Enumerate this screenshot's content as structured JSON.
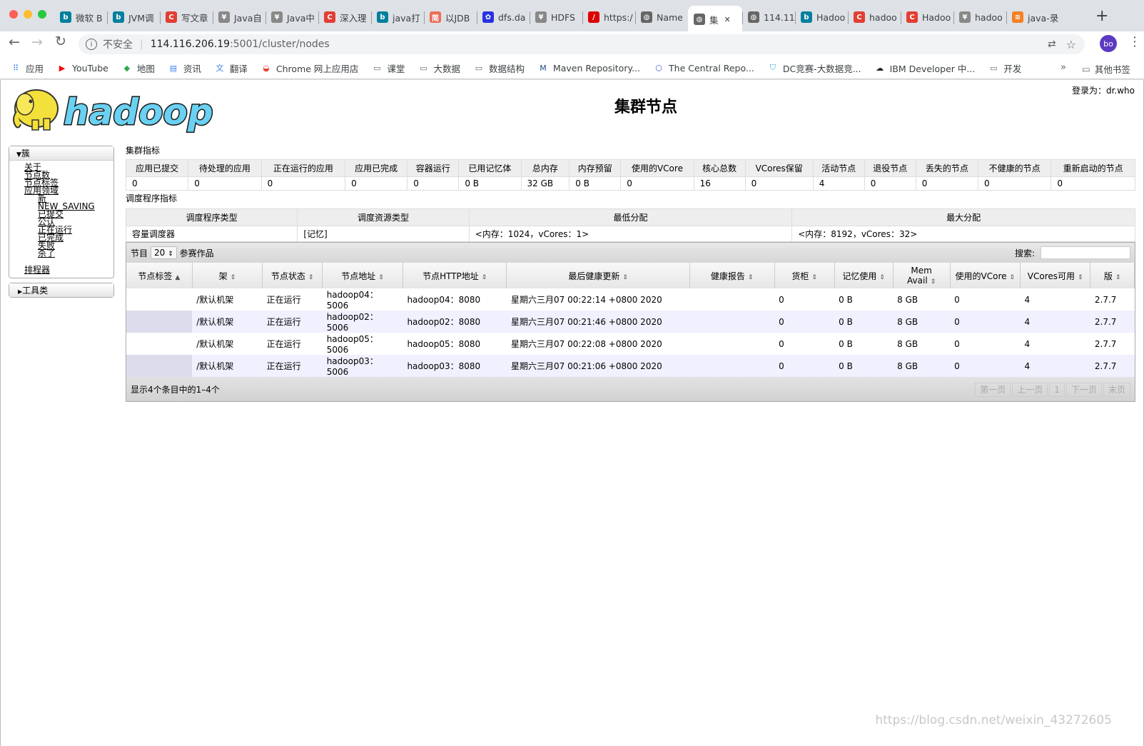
{
  "browser": {
    "tabs": [
      {
        "label": "微软 B",
        "fav": "b",
        "color": "#00809d"
      },
      {
        "label": "JVM调",
        "fav": "b",
        "color": "#00809d"
      },
      {
        "label": "写文章",
        "fav": "C",
        "color": "#e33e33"
      },
      {
        "label": "Java自",
        "fav": "¥",
        "color": "#888"
      },
      {
        "label": "Java中",
        "fav": "¥",
        "color": "#888"
      },
      {
        "label": "深入理",
        "fav": "C",
        "color": "#e33e33"
      },
      {
        "label": "java打",
        "fav": "b",
        "color": "#00809d"
      },
      {
        "label": "以JDB",
        "fav": "简",
        "color": "#ea6f5a"
      },
      {
        "label": "dfs.da",
        "fav": "✿",
        "color": "#2932e1"
      },
      {
        "label": "HDFS",
        "fav": "¥",
        "color": "#888"
      },
      {
        "label": "https:/",
        "fav": "/",
        "color": "#d00"
      },
      {
        "label": "Name",
        "fav": "◍",
        "color": "#666"
      },
      {
        "label": "集",
        "fav": "◍",
        "color": "#666",
        "active": true
      },
      {
        "label": "114.11",
        "fav": "◍",
        "color": "#666"
      },
      {
        "label": "Hadoo",
        "fav": "b",
        "color": "#00809d"
      },
      {
        "label": "hadoo",
        "fav": "C",
        "color": "#e33e33"
      },
      {
        "label": "Hadoo",
        "fav": "C",
        "color": "#e33e33"
      },
      {
        "label": "hadoo",
        "fav": "¥",
        "color": "#888"
      },
      {
        "label": "java-录",
        "fav": "≋",
        "color": "#f48024"
      }
    ],
    "new_tab": "+",
    "security_label": "不安全",
    "url_host": "114.116.206.19",
    "url_rest": ":5001/cluster/nodes",
    "avatar": "bo",
    "bookmarks": [
      {
        "label": "应用",
        "icon": "apps-grid-icon",
        "glyph": "⠿",
        "color": "#1a73e8"
      },
      {
        "label": "YouTube",
        "icon": "youtube-icon",
        "glyph": "▶",
        "color": "#ff0000"
      },
      {
        "label": "地图",
        "icon": "maps-icon",
        "glyph": "◆",
        "color": "#34a853"
      },
      {
        "label": "资讯",
        "icon": "news-icon",
        "glyph": "▤",
        "color": "#4285f4"
      },
      {
        "label": "翻译",
        "icon": "translate-icon",
        "glyph": "文",
        "color": "#4285f4"
      },
      {
        "label": "Chrome 网上应用店",
        "icon": "webstore-icon",
        "glyph": "◒",
        "color": "#ea4335"
      },
      {
        "label": "课堂",
        "icon": "folder-icon",
        "glyph": "▭",
        "color": "#5f6368"
      },
      {
        "label": "大数据",
        "icon": "folder-icon",
        "glyph": "▭",
        "color": "#5f6368"
      },
      {
        "label": "数据结构",
        "icon": "folder-icon",
        "glyph": "▭",
        "color": "#5f6368"
      },
      {
        "label": "Maven Repository...",
        "icon": "maven-icon",
        "glyph": "M",
        "color": "#1a4c8b"
      },
      {
        "label": "The Central Repo...",
        "icon": "hexagon-icon",
        "glyph": "⬡",
        "color": "#3b5bdb"
      },
      {
        "label": "DC竞赛-大数据竞...",
        "icon": "dc-shield-icon",
        "glyph": "⛉",
        "color": "#3aa7d8"
      },
      {
        "label": "IBM Developer 中...",
        "icon": "ibm-icon",
        "glyph": "☁",
        "color": "#222"
      },
      {
        "label": "开发",
        "icon": "folder-icon",
        "glyph": "▭",
        "color": "#5f6368"
      }
    ],
    "more": "»",
    "other_bookmarks": "其他书签"
  },
  "header": {
    "logo_text": "hadoop",
    "title": "集群节点",
    "login": "登录为：dr.who"
  },
  "nav": {
    "cluster_label": "簇",
    "links": [
      "关于",
      "节点数",
      "节点标签",
      "应用领域"
    ],
    "app_states": [
      "新",
      "NEW_SAVING",
      "已提交",
      "公认",
      "正在运行",
      "已完成",
      "失败",
      "杀了"
    ],
    "scheduler": "排程器",
    "tools_label": "工具类"
  },
  "cluster_metrics": {
    "title": "集群指标",
    "headers": [
      "应用已提交",
      "待处理的应用",
      "正在运行的应用",
      "应用已完成",
      "容器运行",
      "已用记忆体",
      "总内存",
      "内存预留",
      "使用的VCore",
      "核心总数",
      "VCores保留",
      "活动节点",
      "退役节点",
      "丢失的节点",
      "不健康的节点",
      "重新启动的节点"
    ],
    "values": [
      "0",
      "0",
      "0",
      "0",
      "0",
      "0 B",
      "32 GB",
      "0 B",
      "0",
      "16",
      "0",
      "4",
      "0",
      "0",
      "0",
      "0"
    ]
  },
  "scheduler_metrics": {
    "title": "调度程序指标",
    "headers": [
      "调度程序类型",
      "调度资源类型",
      "最低分配",
      "最大分配"
    ],
    "values": [
      "容量调度器",
      "[记忆]",
      "<内存：1024，vCores：1>",
      "<内存：8192，vCores：32>"
    ]
  },
  "nodes_table": {
    "length_label_prefix": "节目",
    "length_value": "20",
    "length_label_suffix": "参赛作品",
    "search_label": "搜索:",
    "search_value": "",
    "headers": [
      "节点标签",
      "架",
      "节点状态",
      "节点地址",
      "节点HTTP地址",
      "最后健康更新",
      "健康报告",
      "货柜",
      "记忆使用",
      "Mem Avail",
      "使用的VCore",
      "VCores可用",
      "版"
    ],
    "rows": [
      [
        "",
        "/默认机架",
        "正在运行",
        "hadoop04：5006",
        "hadoop04：8080",
        "星期六三月07 00:22:14 +0800 2020",
        "",
        "0",
        "0 B",
        "8 GB",
        "0",
        "4",
        "2.7.7"
      ],
      [
        "",
        "/默认机架",
        "正在运行",
        "hadoop02：5006",
        "hadoop02：8080",
        "星期六三月07 00:21:46 +0800 2020",
        "",
        "0",
        "0 B",
        "8 GB",
        "0",
        "4",
        "2.7.7"
      ],
      [
        "",
        "/默认机架",
        "正在运行",
        "hadoop05：5006",
        "hadoop05：8080",
        "星期六三月07 00:22:08 +0800 2020",
        "",
        "0",
        "0 B",
        "8 GB",
        "0",
        "4",
        "2.7.7"
      ],
      [
        "",
        "/默认机架",
        "正在运行",
        "hadoop03：5006",
        "hadoop03：8080",
        "星期六三月07 00:21:06 +0800 2020",
        "",
        "0",
        "0 B",
        "8 GB",
        "0",
        "4",
        "2.7.7"
      ]
    ],
    "info": "显示4个条目中的1–4个",
    "paginate": [
      "第一页",
      "上一页",
      "1",
      "下一页",
      "末页"
    ]
  },
  "watermark": "https://blog.csdn.net/weixin_43272605"
}
